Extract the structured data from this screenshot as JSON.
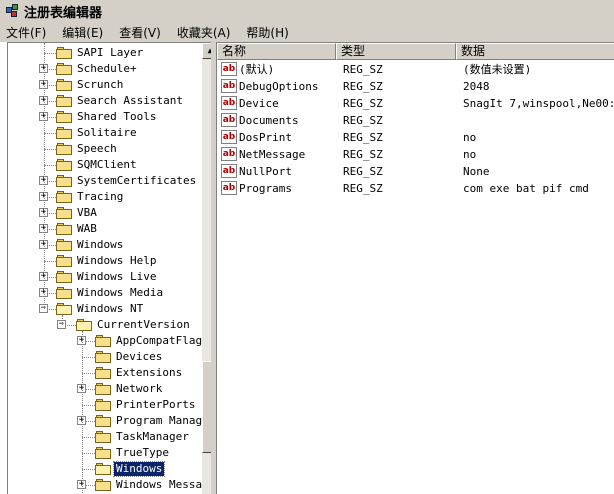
{
  "window": {
    "title": "注册表编辑器"
  },
  "menu": [
    {
      "label": "文件(F)"
    },
    {
      "label": "编辑(E)"
    },
    {
      "label": "查看(V)"
    },
    {
      "label": "收藏夹(A)"
    },
    {
      "label": "帮助(H)"
    }
  ],
  "tree": {
    "items": [
      {
        "label": "SAPI Layer",
        "level": 1,
        "expandable": false
      },
      {
        "label": "Schedule+",
        "level": 1,
        "expandable": true
      },
      {
        "label": "Scrunch",
        "level": 1,
        "expandable": true
      },
      {
        "label": "Search Assistant",
        "level": 1,
        "expandable": true
      },
      {
        "label": "Shared Tools",
        "level": 1,
        "expandable": true
      },
      {
        "label": "Solitaire",
        "level": 1,
        "expandable": false
      },
      {
        "label": "Speech",
        "level": 1,
        "expandable": false
      },
      {
        "label": "SQMClient",
        "level": 1,
        "expandable": false
      },
      {
        "label": "SystemCertificates",
        "level": 1,
        "expandable": true
      },
      {
        "label": "Tracing",
        "level": 1,
        "expandable": true
      },
      {
        "label": "VBA",
        "level": 1,
        "expandable": true
      },
      {
        "label": "WAB",
        "level": 1,
        "expandable": true
      },
      {
        "label": "Windows",
        "level": 1,
        "expandable": true
      },
      {
        "label": "Windows Help",
        "level": 1,
        "expandable": false
      },
      {
        "label": "Windows Live",
        "level": 1,
        "expandable": true
      },
      {
        "label": "Windows Media",
        "level": 1,
        "expandable": true
      },
      {
        "label": "Windows NT",
        "level": 1,
        "expandable": true,
        "expanded": true
      },
      {
        "label": "CurrentVersion",
        "level": 2,
        "expandable": true,
        "expanded": true
      },
      {
        "label": "AppCompatFlag",
        "level": 3,
        "expandable": true
      },
      {
        "label": "Devices",
        "level": 3,
        "expandable": false
      },
      {
        "label": "Extensions",
        "level": 3,
        "expandable": false
      },
      {
        "label": "Network",
        "level": 3,
        "expandable": true
      },
      {
        "label": "PrinterPorts",
        "level": 3,
        "expandable": false
      },
      {
        "label": "Program Manag",
        "level": 3,
        "expandable": true
      },
      {
        "label": "TaskManager",
        "level": 3,
        "expandable": false
      },
      {
        "label": "TrueType",
        "level": 3,
        "expandable": false
      },
      {
        "label": "Windows",
        "level": 3,
        "expandable": false,
        "selected": true
      },
      {
        "label": "Windows Messa",
        "level": 3,
        "expandable": true
      }
    ]
  },
  "list": {
    "columns": [
      "名称",
      "类型",
      "数据"
    ],
    "rows": [
      {
        "name": "(默认)",
        "type": "REG_SZ",
        "data": "(数值未设置)"
      },
      {
        "name": "DebugOptions",
        "type": "REG_SZ",
        "data": "2048"
      },
      {
        "name": "Device",
        "type": "REG_SZ",
        "data": "SnagIt 7,winspool,Ne00:"
      },
      {
        "name": "Documents",
        "type": "REG_SZ",
        "data": ""
      },
      {
        "name": "DosPrint",
        "type": "REG_SZ",
        "data": "no"
      },
      {
        "name": "NetMessage",
        "type": "REG_SZ",
        "data": "no"
      },
      {
        "name": "NullPort",
        "type": "REG_SZ",
        "data": "None"
      },
      {
        "name": "Programs",
        "type": "REG_SZ",
        "data": "com exe bat pif cmd"
      }
    ],
    "value_icon": "ab"
  },
  "colors": {
    "selection": "#0a246a",
    "face": "#d4d0c8"
  }
}
